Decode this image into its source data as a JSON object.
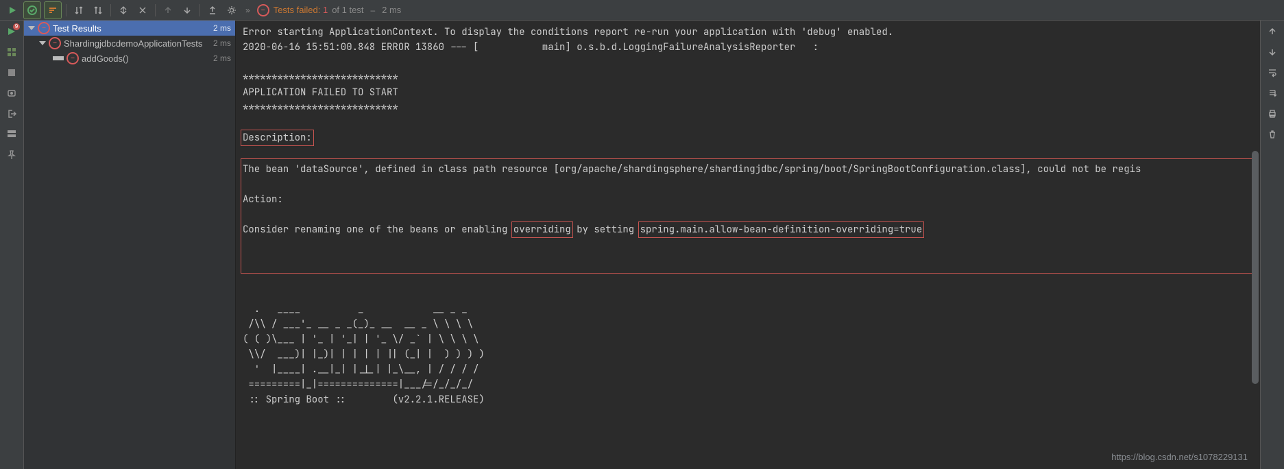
{
  "toolbar": {
    "status_label": "Tests failed:",
    "failed_count": "1",
    "of_total": "of 1 test",
    "duration": "2 ms"
  },
  "tree": {
    "root": {
      "label": "Test Results",
      "duration": "2 ms"
    },
    "suite": {
      "label": "ShardingjdbcdemoApplicationTests",
      "duration": "2 ms"
    },
    "test": {
      "label": "addGoods()",
      "duration": "2 ms"
    }
  },
  "console": {
    "line1": "Error starting ApplicationContext. To display the conditions report re-run your application with 'debug' enabled.",
    "line2": "2020-06-16 15:51:00.848 ERROR 13860 --- [           main] o.s.b.d.LoggingFailureAnalysisReporter   :",
    "stars": "***************************",
    "fail_header": "APPLICATION FAILED TO START",
    "desc_label": "Description:",
    "desc_body": "The bean 'dataSource', defined in class path resource [org/apache/shardingsphere/shardingjdbc/spring/boot/SpringBootConfiguration.class], could not be regis",
    "action_label": "Action:",
    "action_pre": "Consider renaming one of the beans or enabling ",
    "action_word": "overriding",
    "action_mid": " by setting ",
    "action_prop": "spring.main.allow-bean-definition-overriding=true",
    "banner1": "  .   ____          _            __ _ _",
    "banner2": " /\\\\ / ___'_ __ _ _(_)_ __  __ _ \\ \\ \\ \\",
    "banner3": "( ( )\\___ | '_ | '_| | '_ \\/ _` | \\ \\ \\ \\",
    "banner4": " \\\\/  ___)| |_)| | | | | || (_| |  ) ) ) )",
    "banner5": "  '  |____| .__|_| |_|_| |_\\__, | / / / /",
    "banner6": " =========|_|==============|___/=/_/_/_/",
    "banner7": " :: Spring Boot ::        (v2.2.1.RELEASE)"
  },
  "watermark": "https://blog.csdn.net/s1078229131"
}
